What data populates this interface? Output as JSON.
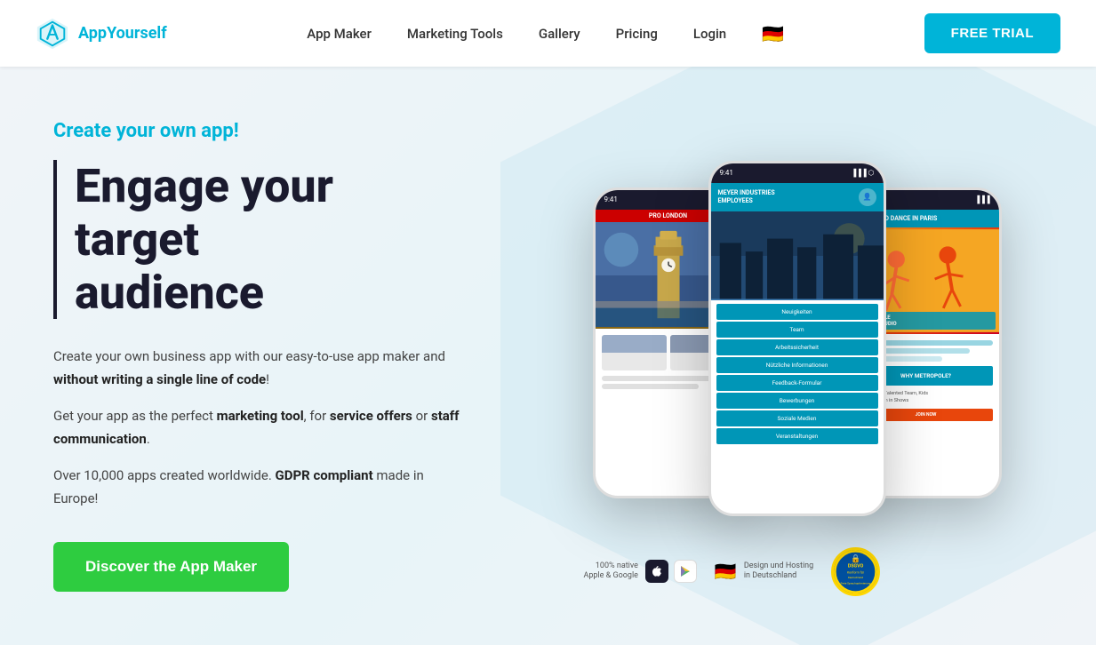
{
  "header": {
    "logo_text_plain": "App",
    "logo_text_accent": "Yourself",
    "nav": {
      "items": [
        {
          "label": "App Maker",
          "id": "app-maker"
        },
        {
          "label": "Marketing Tools",
          "id": "marketing-tools"
        },
        {
          "label": "Gallery",
          "id": "gallery"
        },
        {
          "label": "Pricing",
          "id": "pricing"
        },
        {
          "label": "Login",
          "id": "login"
        }
      ],
      "flag": "🇩🇪"
    },
    "cta_label": "FREE TRIAL"
  },
  "hero": {
    "create_label": "Create your own app!",
    "headline_line1": "Engage your target",
    "headline_line2": "audience",
    "body1_pre": "Create your own business app with our easy-to-use app maker and ",
    "body1_bold": "without writing a single line of code",
    "body1_post": "!",
    "body2_pre": "Get your app as the perfect ",
    "body2_bold1": "marketing tool",
    "body2_mid": ", for ",
    "body2_bold2": "service offers",
    "body2_mid2": " or ",
    "body2_bold3": "staff communication",
    "body2_post": ".",
    "body3_pre": "Over 10,000 apps created worldwide. ",
    "body3_bold": "GDPR compliant",
    "body3_post": " made in Europe!",
    "cta_label": "Discover the App Maker"
  },
  "phones": {
    "center": {
      "status": "9:41",
      "header_line1": "MEYER INDUSTRIES",
      "header_line2": "EMPLOYEES",
      "menu_items": [
        "Neuigkeiten",
        "Team",
        "Arbeitssicherheit",
        "Nützliche Informationen",
        "Feedback-Formular",
        "Bewerbungen",
        "Soziale Medien",
        "Veranstaltungen"
      ]
    },
    "left": {
      "label": "PRO LONDON"
    },
    "right": {
      "label": "LEARN TO DANCE IN PARIS",
      "overlay_line1": "METROPOLE",
      "overlay_line2": "DANCE STUDIO"
    }
  },
  "badges": {
    "native_label": "100% native",
    "native_sub": "Apple & Google",
    "design_label": "Design und Hosting",
    "design_sub": "in Deutschland",
    "dsgvo_label": "DSGVO"
  }
}
